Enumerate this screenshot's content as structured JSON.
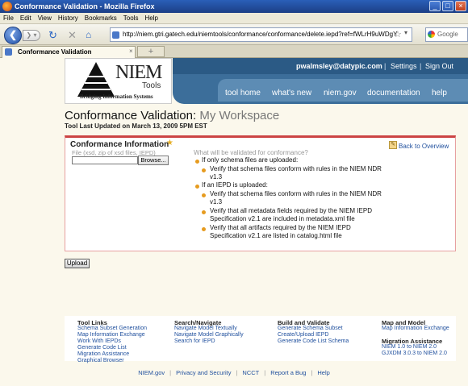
{
  "window": {
    "title": "Conformance Validation - Mozilla Firefox"
  },
  "menu": [
    "File",
    "Edit",
    "View",
    "History",
    "Bookmarks",
    "Tools",
    "Help"
  ],
  "address": {
    "url": "http://niem.gtri.gatech.edu/niemtools/conformance/conformance/delete.iepd?ref=fWLrH9uWDgY"
  },
  "search": {
    "placeholder": "Google"
  },
  "tab": {
    "label": "Conformance Validation",
    "new_tab": "+"
  },
  "header": {
    "logo_word": "NIEM",
    "logo_sub": "Tools",
    "logo_tagline": "Bridging Information Systems",
    "email": "pwalmsley@datypic.com",
    "settings": "Settings",
    "signout": "Sign Out",
    "sep": "|",
    "nav": [
      "tool home",
      "what's new",
      "niem.gov",
      "documentation",
      "help"
    ]
  },
  "page": {
    "title": "Conformance Validation:",
    "subtitle": "My Workspace",
    "updated": "Tool Last Updated on March 13, 2009 5PM EST"
  },
  "panel": {
    "title": "Conformance Information",
    "file_formats": "File (xsd, zip of xsd files, IEPD)",
    "browse_label": "Browse...",
    "back_link": "Back to Overview",
    "question": "What will be validated for conformance?",
    "lines": [
      "If only schema files are uploaded:",
      "Verify that schema files conform with rules in the NIEM NDR",
      "v1.3",
      "If an IEPD is uploaded:",
      "Verify that schema files conform with rules in the NIEM NDR",
      "v1.3",
      "Verify that all metadata fields required by the NIEM IEPD",
      "Specification v2.1 are included in metadata.xml file",
      "Verify that all artifacts required by the NIEM IEPD",
      "Specification v2.1 are listed in catalog.html file"
    ]
  },
  "upload_label": "Upload",
  "footer": {
    "col1": {
      "title": "Tool Links",
      "links": [
        "Schema Subset Generation",
        "Map Information Exchange",
        "Work With IEPDs",
        "Generate Code List",
        "Migration Assistance",
        "Graphical Browser"
      ]
    },
    "col2": {
      "title": "Search/Navigate",
      "links": [
        "Navigate Model Textually",
        "Navigate Model Graphically",
        "Search for IEPD"
      ]
    },
    "col3": {
      "title": "Build and Validate",
      "links": [
        "Generate Schema Subset",
        "Create/Upload IEPD",
        "Generate Code List Schema"
      ]
    },
    "col4": {
      "title": "Map and Model",
      "links": [
        "Map Information Exchange"
      ]
    },
    "col5": {
      "title": "Migration Assistance",
      "links": [
        "NIEM 1.0 to NIEM 2.0",
        "GJXDM 3.0.3 to NIEM 2.0"
      ]
    },
    "bottom": [
      "NIEM.gov",
      "Privacy and Security",
      "NCCT",
      "Report a Bug",
      "Help"
    ]
  }
}
